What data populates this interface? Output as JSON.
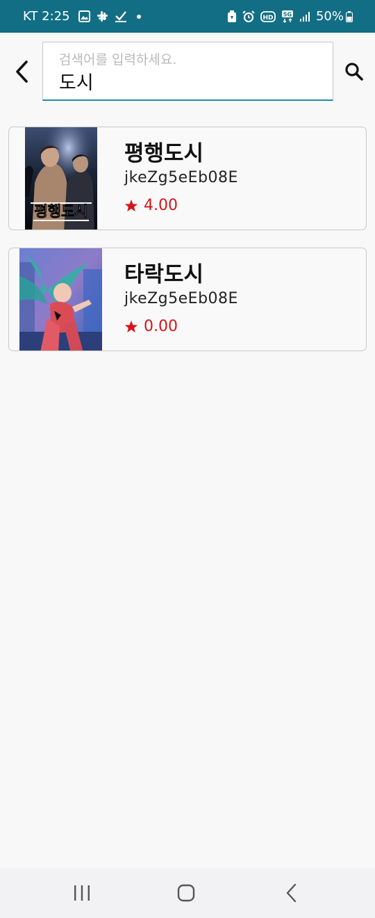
{
  "status_bar": {
    "carrier_time": "KT 2:25",
    "battery": "50%",
    "icons_left": [
      "gallery-icon",
      "slack-icon",
      "check-icon",
      "dot"
    ],
    "icons_right": [
      "battery-saver-icon",
      "alarm-icon",
      "hd-icon",
      "5g-icon",
      "signal-icon",
      "battery-icon"
    ],
    "background": "#126e85"
  },
  "search": {
    "placeholder": "검색어를 입력하세요.",
    "value": "도시",
    "accent": "#1f8aa8"
  },
  "results": [
    {
      "title": "평행도시",
      "author": "jkeZg5eEb08E",
      "rating": "4.00",
      "cover_text": "평행도시"
    },
    {
      "title": "타락도시",
      "author": "jkeZg5eEb08E",
      "rating": "0.00"
    }
  ],
  "colors": {
    "rating": "#d8141a",
    "background": "#f8f8f9"
  },
  "nav": [
    "recent-apps-button",
    "home-button",
    "back-button"
  ]
}
